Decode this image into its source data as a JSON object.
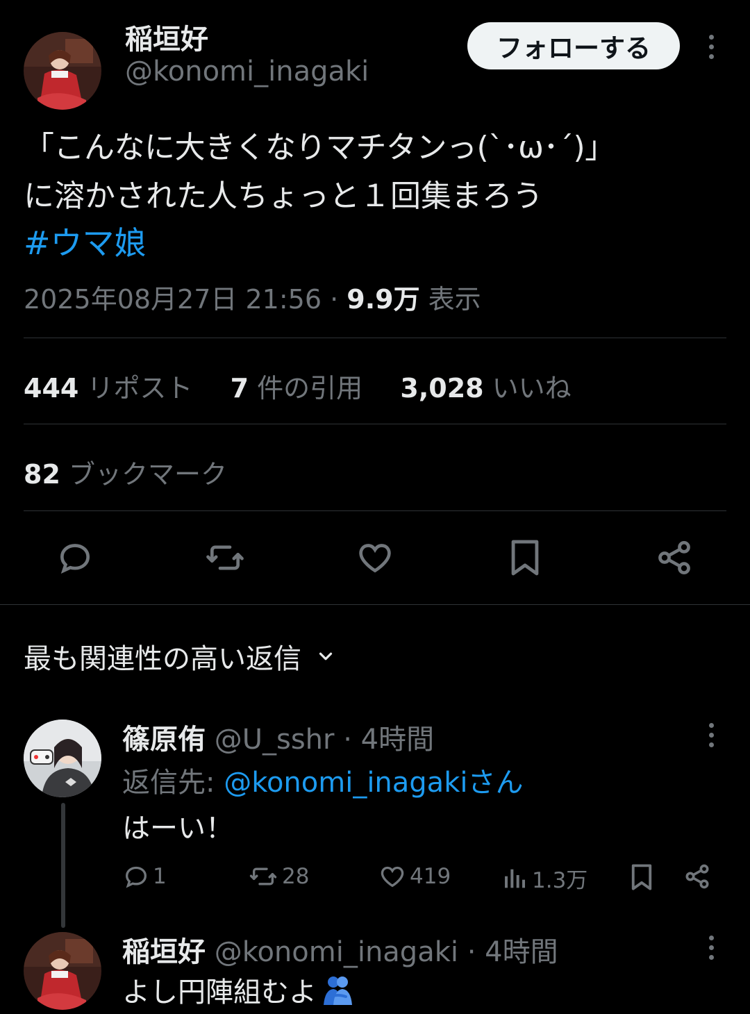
{
  "tweet": {
    "author_name": "稲垣好",
    "author_handle": "@konomi_inagaki",
    "follow_label": "フォローする",
    "text_line1": "「こんなに大きくなりマチタンっ(`･ω･´)」",
    "text_line2": "に溶かされた人ちょっと１回集まろう",
    "hashtag": "#ウマ娘",
    "timestamp": "2025年08月27日 21:56 · ",
    "views_count": "9.9万",
    "views_label": " 表示"
  },
  "stats": {
    "reposts_count": "444",
    "reposts_label": "リポスト",
    "quotes_count": "7",
    "quotes_label": "件の引用",
    "likes_count": "3,028",
    "likes_label": "いいね",
    "bookmarks_count": "82",
    "bookmarks_label": "ブックマーク"
  },
  "icons": [
    "reply-icon",
    "repost-icon",
    "like-icon",
    "bookmark-icon",
    "share-icon",
    "more-icon",
    "chevron-down-icon",
    "views-icon",
    "people-hugging-emoji"
  ],
  "replies_sort": {
    "label": "最も関連性の高い返信"
  },
  "replies": [
    {
      "author_name": "篠原侑",
      "author_handle": "@U_sshr",
      "time": " · 4時間",
      "reply_to_prefix": "返信先: ",
      "reply_to_handle": "@konomi_inagakiさん",
      "text": "はーい！",
      "reply_count": "1",
      "repost_count": "28",
      "like_count": "419",
      "view_count": "1.3万"
    },
    {
      "author_name": "稲垣好",
      "author_handle": "@konomi_inagaki",
      "time": " · 4時間",
      "text": "よし円陣組むよ"
    }
  ],
  "colors": {
    "background": "#000000",
    "text": "#e7e9ea",
    "muted": "#71767b",
    "accent": "#1d9bf0",
    "divider": "#2f3336",
    "follow_bg": "#eff3f4"
  }
}
